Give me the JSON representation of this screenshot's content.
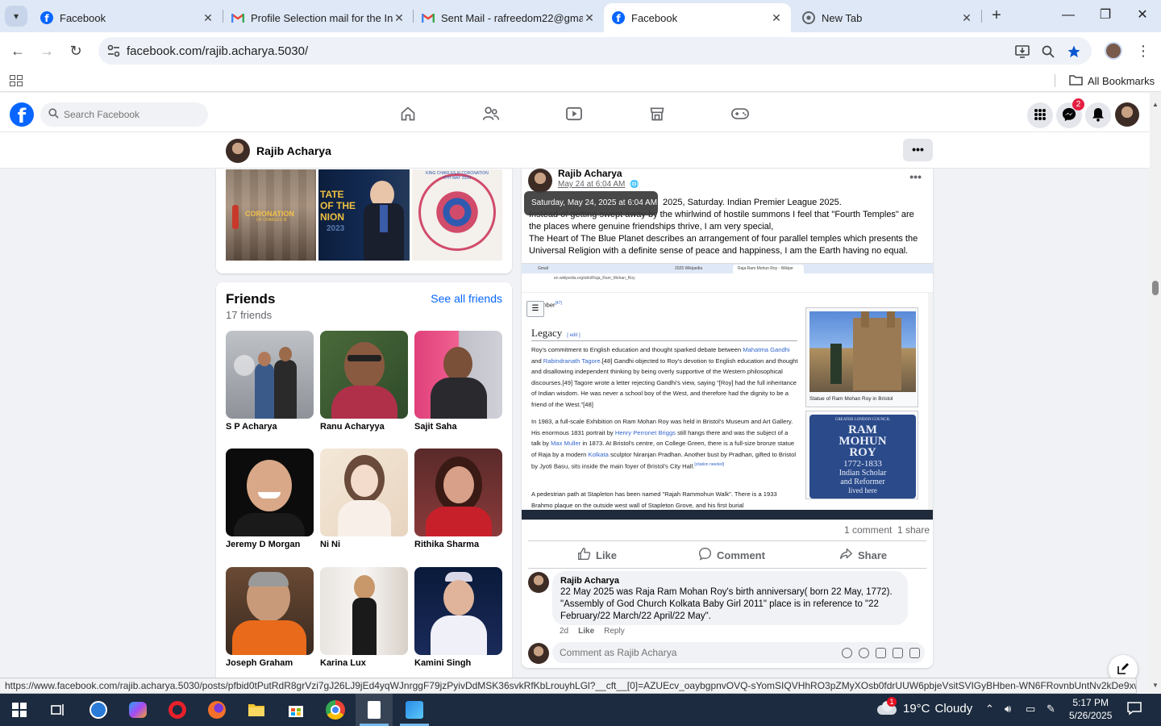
{
  "browser": {
    "tabs": [
      {
        "title": "Facebook",
        "icon": "facebook-icon",
        "active": false
      },
      {
        "title": "Profile Selection mail for the In",
        "icon": "gmail-icon",
        "active": false
      },
      {
        "title": "Sent Mail - rafreedom22@gma",
        "icon": "gmail-icon",
        "active": false
      },
      {
        "title": "Facebook",
        "icon": "facebook-icon",
        "active": true
      },
      {
        "title": "New Tab",
        "icon": "chrome-icon",
        "active": false
      }
    ],
    "url": "facebook.com/rajib.acharya.5030/",
    "all_bookmarks": "All Bookmarks",
    "status_url": "https://www.facebook.com/rajib.acharya.5030/posts/pfbid0tPutRdR8grVzi7gJ26LJ9jEd4yqWJnrggF79jzPyivDdMSK36svkRfKbLrouyhLGl?__cft__[0]=AZUEcv_oaybgpnvOVQ-sYomSIQVHhRO3pZMyXOsb0fdrUUW6pbjeVsitSVIGyBHben-WN6FRovnbUntNv2kDe9xwnm3..."
  },
  "facebook": {
    "search_placeholder": "Search Facebook",
    "messenger_badge": "2",
    "profile_name": "Rajib Acharya",
    "photo_titles": [
      "CORONATION",
      "OF CHARLES III",
      "TATE",
      "OF THE",
      "NION",
      "2023",
      "KING CHARLES III CORONATION 6TH MAY 2023"
    ],
    "friends": {
      "title": "Friends",
      "count": "17 friends",
      "see_all": "See all friends",
      "list": [
        {
          "name": "S P Acharya"
        },
        {
          "name": "Ranu Acharyya"
        },
        {
          "name": "Sajit Saha"
        },
        {
          "name": "Jeremy D Morgan"
        },
        {
          "name": "Ni Ni"
        },
        {
          "name": "Rithika Sharma"
        },
        {
          "name": "Joseph Graham"
        },
        {
          "name": "Karina Lux"
        },
        {
          "name": "Kamini Singh"
        }
      ]
    },
    "post": {
      "author": "Rajib Acharya",
      "date": "May 24 at 6:04 AM",
      "tooltip": "Saturday, May 24, 2025 at 6:04 AM",
      "line1_tail": "2025, Saturday. Indian Premier League 2025.",
      "line2": "Instead of getting swept away by the whirlwind of hostile summons I feel that \"Fourth Temples\" are the places where genuine friendships thrive, I am very special,",
      "line3": "The Heart of The Blue Planet describes an arrangement of four parallel temples which presents the Universal Religion with a definite sense of peace and happiness, I am the Earth having no equal.",
      "comments_count": "1 comment",
      "shares_count": "1 share",
      "like": "Like",
      "comment": "Comment",
      "share": "Share",
      "screenshot": {
        "tabs": [
          "Gmail",
          "2025 Wikipedia",
          "Raja Ram Mohun Roy - Wikipe"
        ],
        "url": "en.wikipedia.org/wiki/Raja_Ram_Mohan_Roy",
        "ember": "...ember",
        "ember_ref": "[47]",
        "heading": "Legacy",
        "edit": "[ edit ]",
        "p1_a": "Roy's commitment to English education and thought sparked debate between ",
        "p1_link1": "Mahatma Gandhi",
        "p1_b": " and ",
        "p1_link2": "Rabindranath Tagore",
        "p1_c": ".[48] Gandhi objected to Roy's devotion to English education and thought and disallowing independent thinking by being overly supportive of the Western philosophical discourses.[49] Tagore wrote a letter rejecting Gandhi's view, saying \"[Roy] had the full inheritance of Indian wisdom. He was never a school boy of the West, and therefore had the dignity to be a friend of the West.\"[48]",
        "p2_a": "In 1983, a full-scale Exhibition on Ram Mohan Roy was held in Bristol's Museum and Art Gallery. His enormous 1831 portrait by ",
        "p2_link1": "Henry Perronet Briggs",
        "p2_b": " still hangs there and was the subject of a talk by ",
        "p2_link2": "Max Muller",
        "p2_c": " in 1873. At Bristol's centre, on College Green, there is a full-size bronze statue of Raja by a modern ",
        "p2_link3": "Kolkata",
        "p2_d": " sculptor Niranjan Pradhan. Another bust by Pradhan, gifted to Bristol by Jyoti Basu, sits inside the main foyer of Bristol's City Hall.",
        "p2_cite": "[citation needed]",
        "p3": "A pedestrian path at Stapleton has been named \"Rajah Rammohun Walk\". There is a 1933 Brahmo plaque on the outside west wall of Stapleton Grove, and his first burial",
        "caption": "Statue of Ram Mohan Roy in Bristol",
        "plaque_top": "GREATER LONDON COUNCIL",
        "plaque_name": "RAM MOHUN ROY",
        "plaque_years": "1772-1833",
        "plaque_desc1": "Indian Scholar",
        "plaque_desc2": "and Reformer",
        "plaque_desc3": "lived here"
      },
      "top_comment": {
        "author": "Rajib Acharya",
        "text": "22 May 2025 was Raja Ram Mohan Roy's birth anniversary( born 22 May, 1772). \"Assembly of God Church Kolkata Baby Girl 2011\" place is in reference to \"22 February/22 March/22 April/22 May\".",
        "age": "2d",
        "like": "Like",
        "reply": "Reply"
      },
      "comment_placeholder": "Comment as Rajib Acharya"
    }
  },
  "taskbar": {
    "temperature": "19°C",
    "weather": "Cloudy",
    "weather_badge": "1",
    "time": "5:17 PM",
    "date": "5/26/2025"
  },
  "colors": {
    "facebook_blue": "#0866ff",
    "chrome_tabstrip": "#dfe8f6",
    "taskbar": "#1c2b3f",
    "link": "#3366cc"
  }
}
